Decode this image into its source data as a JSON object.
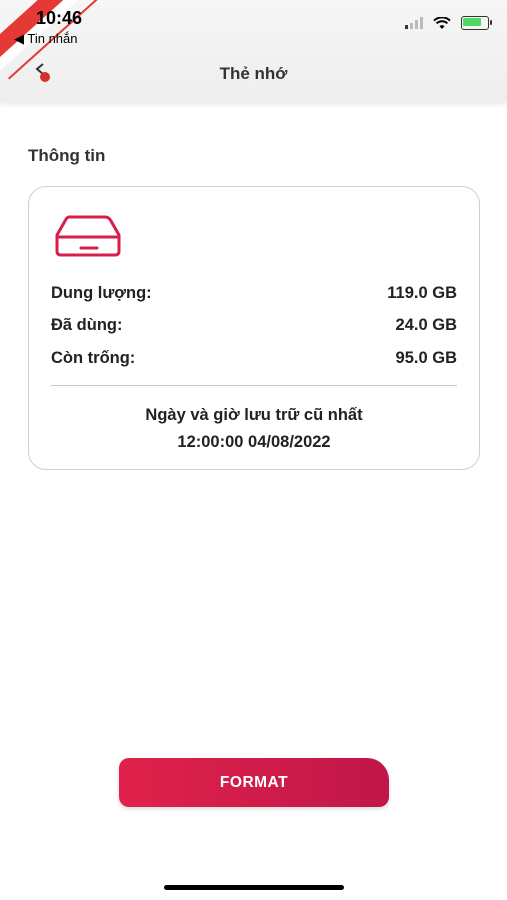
{
  "status_bar": {
    "time": "10:46",
    "back_app": "◀ Tin nhắn"
  },
  "header": {
    "title": "Thẻ nhớ",
    "back_icon": "chevron-left-icon"
  },
  "info": {
    "section_title": "Thông tin",
    "capacity_label": "Dung lượng:",
    "capacity_value": "119.0 GB",
    "used_label": "Đã dùng:",
    "used_value": "24.0 GB",
    "free_label": "Còn trống:",
    "free_value": "95.0 GB",
    "oldest_label": "Ngày và giờ lưu trữ cũ nhất",
    "oldest_value": "12:00:00 04/08/2022"
  },
  "actions": {
    "format_label": "FORMAT"
  },
  "colors": {
    "accent": "#d81e4a",
    "card_border": "#cfcfcf"
  }
}
